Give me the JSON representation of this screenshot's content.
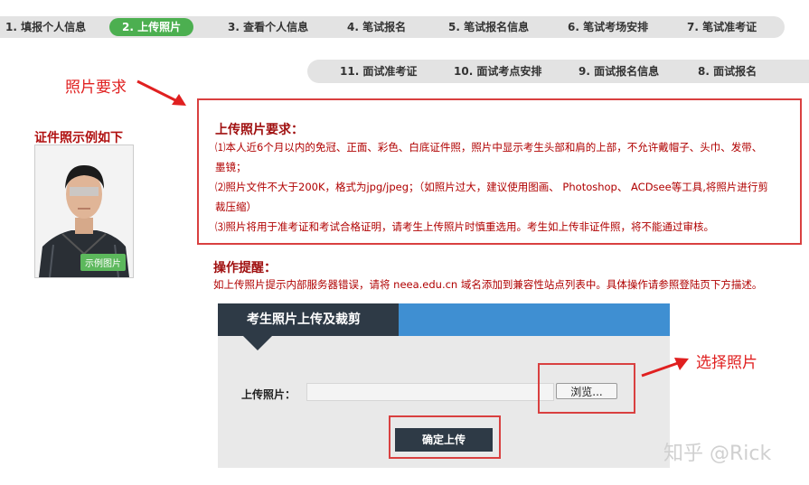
{
  "steps_row1": [
    {
      "label": "1. 填报个人信息",
      "active": false
    },
    {
      "label": "2. 上传照片",
      "active": true
    },
    {
      "label": "3. 查看个人信息",
      "active": false
    },
    {
      "label": "4. 笔试报名",
      "active": false
    },
    {
      "label": "5. 笔试报名信息",
      "active": false
    },
    {
      "label": "6. 笔试考场安排",
      "active": false
    },
    {
      "label": "7. 笔试准考证",
      "active": false
    }
  ],
  "steps_row2": [
    {
      "label": "11. 面试准考证"
    },
    {
      "label": "10. 面试考点安排"
    },
    {
      "label": "9. 面试报名信息"
    },
    {
      "label": "8. 面试报名"
    }
  ],
  "annotations": {
    "photo_req": "照片要求",
    "select_photo": "选择照片"
  },
  "sample": {
    "title": "证件照示例如下",
    "badge": "示例图片"
  },
  "requirements": {
    "title": "上传照片要求：",
    "lines": [
      "⑴本人近6个月以内的免冠、正面、彩色、白底证件照，照片中显示考生头部和肩的上部，不允许戴帽子、头巾、发带、",
      "墨镜；",
      "⑵照片文件不大于200K，格式为jpg/jpeg；（如照片过大，建议使用图画、 Photoshop、 ACDsee等工具,将照片进行剪",
      "裁压缩）",
      "⑶照片将用于准考证和考试合格证明，请考生上传照片时慎重选用。考生如上传非证件照，将不能通过审核。"
    ]
  },
  "tips": {
    "title": "操作提醒：",
    "text": "如上传照片提示内部服务器错误，请将 neea.edu.cn 域名添加到兼容性站点列表中。具体操作请参照登陆页下方描述。"
  },
  "upload_panel": {
    "tab": "考生照片上传及裁剪",
    "label": "上传照片：",
    "browse": "浏览...",
    "confirm": "确定上传"
  },
  "watermark": "知乎 @Rick",
  "colors": {
    "accent_green": "#4caf50",
    "panel_dark": "#2e3a46",
    "panel_blue": "#3f8fd2",
    "annotation_red": "#e02020"
  }
}
